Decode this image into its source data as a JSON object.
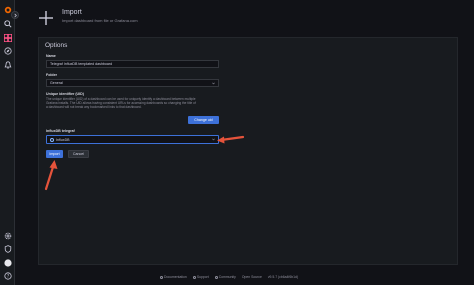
{
  "header": {
    "title": "Import",
    "subtitle": "Import dashboard from file or Grafana.com"
  },
  "options": {
    "title": "Options",
    "name_label": "Name",
    "name_value": "Telegraf InfluxDB templated dashboard",
    "folder_label": "Folder",
    "folder_value": "General",
    "uid_label": "Unique identifier (UID)",
    "uid_help": "The unique identifier (UID) of a dashboard can be used for uniquely identify a dashboard between multiple Grafana installs. The UID allows having consistent URLs for accessing dashboards so changing the title of a dashboard will not break any bookmarked links to that dashboard.",
    "change_uid_label": "Change uid",
    "datasource_label": "InfluxDB telegraf",
    "datasource_value": "InfluxDB",
    "import_label": "Import",
    "cancel_label": "Cancel"
  },
  "footer": {
    "items": [
      "Documentation",
      "Support",
      "Community",
      "Open Source",
      "v9.5.7 (cb6a4f6b1d)"
    ]
  },
  "colors": {
    "accent": "#3d71d9",
    "annotation_arrow": "#e5533b",
    "background": "#111217",
    "panel": "#181b1f"
  },
  "icons": [
    "grafana-logo-icon",
    "search-icon",
    "dashboards-icon",
    "explore-icon",
    "alerting-icon",
    "settings-icon",
    "shield-icon",
    "avatar-icon",
    "help-icon",
    "plus-icon"
  ]
}
